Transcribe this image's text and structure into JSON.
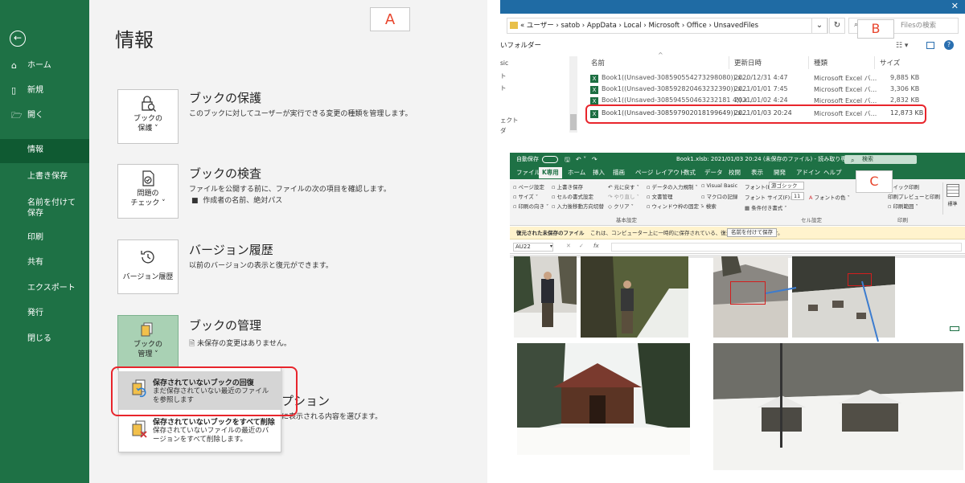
{
  "labels": {
    "a": "A",
    "b": "B",
    "c": "C"
  },
  "backstage": {
    "title": "情報",
    "nav": [
      {
        "label": "ホーム",
        "icon": "home-icon"
      },
      {
        "label": "新規",
        "icon": "new-document-icon"
      },
      {
        "label": "開く",
        "icon": "folder-open-icon"
      }
    ],
    "nav2": [
      "情報",
      "上書き保存",
      "名前を付けて保存",
      "印刷",
      "共有",
      "エクスポート",
      "発行",
      "閉じる"
    ],
    "sections": {
      "protect": {
        "tile": "ブックの\n保護 ˅",
        "heading": "ブックの保護",
        "desc": "このブックに対してユーザーが実行できる変更の種類を管理します。"
      },
      "inspect": {
        "tile": "問題の\nチェック ˅",
        "heading": "ブックの検査",
        "desc": "ファイルを公開する前に、ファイルの次の項目を確認します。",
        "bullet": "作成者の名前、絶対パス"
      },
      "version": {
        "tile": "バージョン履歴",
        "heading": "バージョン履歴",
        "desc": "以前のバージョンの表示と復元ができます。"
      },
      "manage": {
        "tile": "ブックの\n管理 ˅",
        "heading": "ブックの管理",
        "desc": "未保存の変更はありません。"
      },
      "hidden_heading_tail": "プション",
      "hidden_desc_tail": "に表示される内容を選びます。"
    },
    "menu": [
      {
        "title": "保存されていないブックの回復",
        "desc": "まだ保存されていない最近のファイルを参照します"
      },
      {
        "title": "保存されていないブックをすべて削除",
        "desc": "保存されていないファイルの最近のバージョンをすべて削除します。"
      }
    ],
    "colors": {
      "sidebar": "#1e7145",
      "highlight": "#e8252c"
    }
  },
  "explorer": {
    "path": "«  ユーザー  ›  satob  ›  AppData  ›  Local  ›  Microsoft  ›  Office  ›  UnsavedFiles",
    "search_placeholder": "Filesの検索",
    "toolbar": "いフォルダー",
    "side_items": [
      "sic",
      "ト",
      "ト",
      "",
      "ェクト",
      "ダ"
    ],
    "columns": [
      "名前",
      "更新日時",
      "種類",
      "サイズ"
    ],
    "files": [
      {
        "name": "Book1((Unsaved-308590554273298080)).x...",
        "date": "2020/12/31 4:47",
        "type": "Microsoft Excel バ...",
        "size": "9,885 KB"
      },
      {
        "name": "Book1((Unsaved-308592820463232390)).x...",
        "date": "2021/01/01 7:45",
        "type": "Microsoft Excel バ...",
        "size": "3,306 KB"
      },
      {
        "name": "Book1((Unsaved-308594550463232181 4)).x...",
        "date": "2021/01/02 4:24",
        "type": "Microsoft Excel バ...",
        "size": "2,832 KB"
      },
      {
        "name": "Book1((Unsaved-308597902018199649)).x...",
        "date": "2021/01/03 20:24",
        "type": "Microsoft Excel バ...",
        "size": "12,873 KB"
      }
    ]
  },
  "excel": {
    "title": "Book1.xlsb: 2021/01/03 20:24 (未保存のファイル) - 読み取り専用 ⌄",
    "autosave": "自動保存",
    "search": "検索",
    "tabs": [
      "ファイル",
      "K専用",
      "ホーム",
      "挿入",
      "描画",
      "ページ レイアウト",
      "数式",
      "データ",
      "校閲",
      "表示",
      "開発",
      "アドイン",
      "ヘルプ"
    ],
    "ribbon": {
      "col1": [
        "ページ設定",
        "サイズ ˅",
        "印刷の向き ˅"
      ],
      "col2": [
        "上書き保存",
        "セルの書式設定",
        "入力後移動方向切替"
      ],
      "col3": [
        "元に戻す ˅",
        "やり直し ˅",
        "クリア ˅"
      ],
      "col4": [
        "データの入力規制 ˅",
        "文書管理",
        "ウィンドウ枠の固定 ˅"
      ],
      "col5": [
        "Visual Basic",
        "マクロの記録",
        "検索"
      ],
      "font_name_label": "フォント(F):",
      "font_name": "游ゴシック",
      "font_size_label": "フォント サイズ(F):",
      "font_size": "11",
      "font_color": "フォントの色 ˅",
      "cond_format": "条件付き書式 ˅",
      "print_items": [
        "クイック印刷",
        "印刷プレビューと印刷",
        "印刷範囲 ˅"
      ],
      "group_basic": "基本設定",
      "group_cell": "セル設定",
      "group_print": "印刷",
      "big_button": "標準"
    },
    "message": {
      "label": "復元された未保存のファイル",
      "text": "これは、コンピューター上に一時的に保存されている、復元されたファイルです。",
      "button": "名前を付けて保存"
    },
    "namebox": "AU22"
  }
}
